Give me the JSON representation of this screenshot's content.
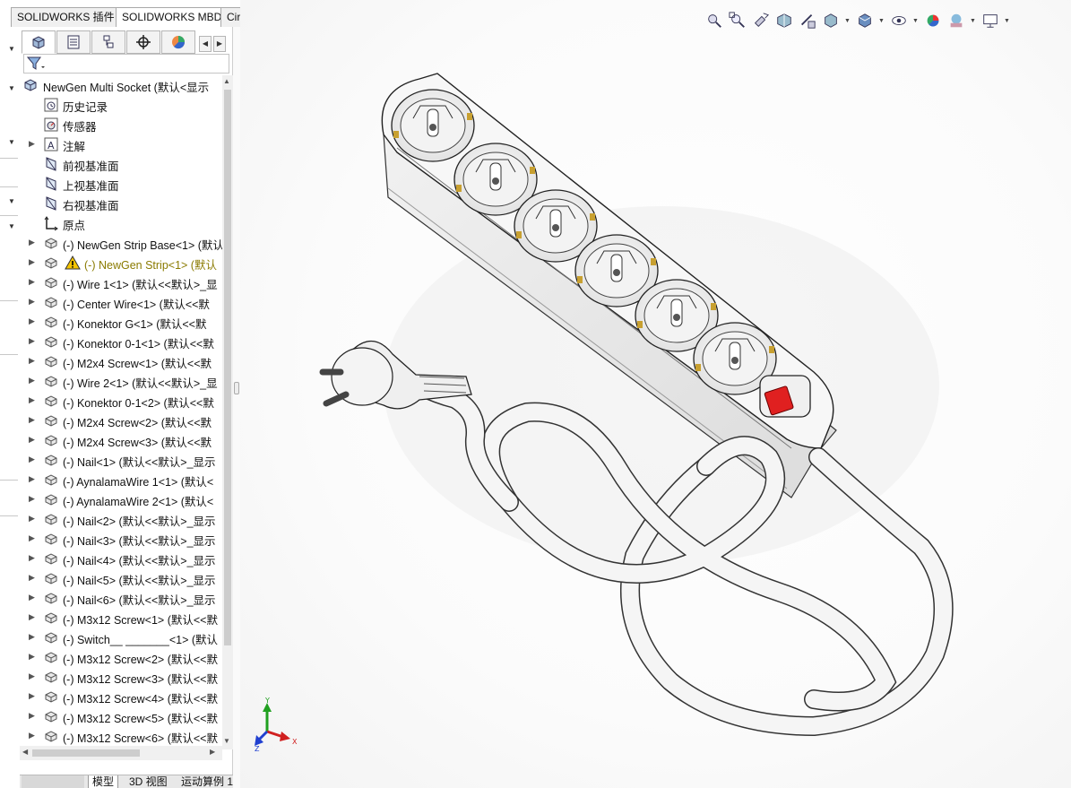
{
  "top_tabs": [
    {
      "label": "SOLIDWORKS 插件",
      "active": false
    },
    {
      "label": "SOLIDWORKS MBD",
      "active": true
    },
    {
      "label": "CircuitWorks",
      "active": false
    }
  ],
  "feature_manager": {
    "tabs": [
      {
        "icon": "feature-manager-icon",
        "active": true
      },
      {
        "icon": "property-manager-icon",
        "active": false
      },
      {
        "icon": "configuration-manager-icon",
        "active": false
      },
      {
        "icon": "dimxpert-manager-icon",
        "active": false
      },
      {
        "icon": "display-manager-icon",
        "active": false
      }
    ],
    "filter_icon": "filter-icon",
    "root": {
      "label": "NewGen Multi Socket  (默认<显示",
      "icon": "assembly-icon"
    },
    "fixed_items": [
      {
        "label": "历史记录",
        "icon": "history-icon",
        "expandable": false
      },
      {
        "label": "传感器",
        "icon": "sensor-icon",
        "expandable": false
      },
      {
        "label": "注解",
        "icon": "annotation-icon",
        "expandable": true
      },
      {
        "label": "前视基准面",
        "icon": "plane-icon",
        "expandable": false
      },
      {
        "label": "上视基准面",
        "icon": "plane-icon",
        "expandable": false
      },
      {
        "label": "右视基准面",
        "icon": "plane-icon",
        "expandable": false
      },
      {
        "label": "原点",
        "icon": "origin-icon",
        "expandable": false
      }
    ],
    "components": [
      {
        "label": "(-) NewGen Strip Base<1> (默认",
        "warning": false
      },
      {
        "label": "(-) NewGen Strip<1> (默认",
        "warning": true
      },
      {
        "label": "(-) Wire 1<1> (默认<<默认>_显",
        "warning": false
      },
      {
        "label": "(-) Center Wire<1> (默认<<默",
        "warning": false
      },
      {
        "label": "(-) Konektor G<1> (默认<<默",
        "warning": false
      },
      {
        "label": "(-) Konektor 0-1<1> (默认<<默",
        "warning": false
      },
      {
        "label": "(-) M2x4 Screw<1> (默认<<默",
        "warning": false
      },
      {
        "label": "(-) Wire 2<1> (默认<<默认>_显",
        "warning": false
      },
      {
        "label": "(-) Konektor 0-1<2> (默认<<默",
        "warning": false
      },
      {
        "label": "(-) M2x4 Screw<2> (默认<<默",
        "warning": false
      },
      {
        "label": "(-) M2x4 Screw<3> (默认<<默",
        "warning": false
      },
      {
        "label": "(-) Nail<1> (默认<<默认>_显示",
        "warning": false
      },
      {
        "label": "(-) AynalamaWire 1<1> (默认<",
        "warning": false
      },
      {
        "label": "(-) AynalamaWire 2<1> (默认<",
        "warning": false
      },
      {
        "label": "(-) Nail<2> (默认<<默认>_显示",
        "warning": false
      },
      {
        "label": "(-) Nail<3> (默认<<默认>_显示",
        "warning": false
      },
      {
        "label": "(-) Nail<4> (默认<<默认>_显示",
        "warning": false
      },
      {
        "label": "(-) Nail<5> (默认<<默认>_显示",
        "warning": false
      },
      {
        "label": "(-) Nail<6> (默认<<默认>_显示",
        "warning": false
      },
      {
        "label": "(-) M3x12 Screw<1> (默认<<默",
        "warning": false
      },
      {
        "label": "(-) Switch__ _______<1> (默认",
        "warning": false
      },
      {
        "label": "(-) M3x12 Screw<2> (默认<<默",
        "warning": false
      },
      {
        "label": "(-) M3x12 Screw<3> (默认<<默",
        "warning": false
      },
      {
        "label": "(-) M3x12 Screw<4> (默认<<默",
        "warning": false
      },
      {
        "label": "(-) M3x12 Screw<5> (默认<<默",
        "warning": false
      },
      {
        "label": "(-) M3x12 Screw<6> (默认<<默",
        "warning": false
      }
    ],
    "bottom_tabs": [
      {
        "label": "模型",
        "active": true
      },
      {
        "label": "3D 视图",
        "active": false
      },
      {
        "label": "运动算例 1",
        "active": false
      }
    ]
  },
  "heads_up_toolbar": [
    {
      "icon": "zoom-to-fit-icon",
      "dropdown": false
    },
    {
      "icon": "zoom-to-area-icon",
      "dropdown": false
    },
    {
      "icon": "previous-view-icon",
      "dropdown": false
    },
    {
      "icon": "section-view-icon",
      "dropdown": false
    },
    {
      "icon": "dynamic-annotation-icon",
      "dropdown": false
    },
    {
      "icon": "view-orientation-icon",
      "dropdown": true
    },
    {
      "icon": "display-style-icon",
      "dropdown": true
    },
    {
      "icon": "hide-show-items-icon",
      "dropdown": true
    },
    {
      "icon": "edit-appearance-icon",
      "dropdown": false
    },
    {
      "icon": "apply-scene-icon",
      "dropdown": true
    },
    {
      "icon": "view-settings-icon",
      "dropdown": true
    }
  ],
  "triad_labels": {
    "x": "X",
    "y": "Y",
    "z": "Z"
  },
  "colors": {
    "switch_red": "#e02020",
    "accent_gold": "#c8a030",
    "triad_x": "#d02020",
    "triad_y": "#20a020",
    "triad_z": "#2040d0"
  }
}
